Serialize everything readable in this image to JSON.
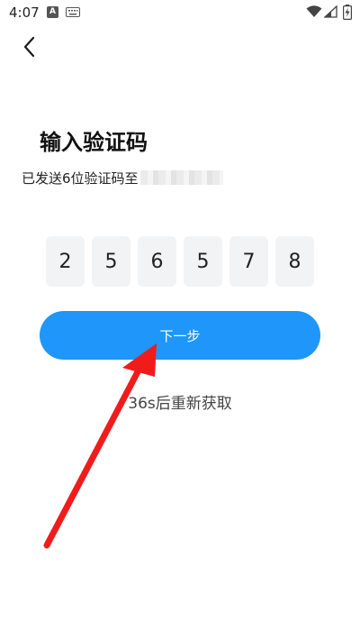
{
  "status_bar": {
    "time": "4:07",
    "badge_letter": "A"
  },
  "header": {
    "title": "输入验证码",
    "subtitle": "已发送6位验证码至"
  },
  "code": {
    "digits": [
      "2",
      "5",
      "6",
      "5",
      "7",
      "8"
    ]
  },
  "actions": {
    "next_label": "下一步",
    "resend_text": "36s后重新获取"
  },
  "colors": {
    "accent": "#1e96fa",
    "arrow": "#f01c1c",
    "box_bg": "#f2f3f5"
  }
}
